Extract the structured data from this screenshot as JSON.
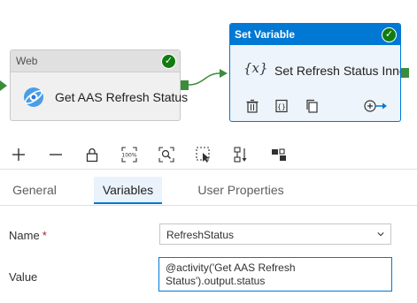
{
  "pipeline": {
    "web_activity": {
      "type_label": "Web",
      "name": "Get AAS Refresh Status",
      "status": "succeeded"
    },
    "set_variable_activity": {
      "type_label": "Set Variable",
      "name": "Set Refresh Status Inne",
      "status": "succeeded",
      "fx_symbol": "{x}"
    }
  },
  "toolbar": {
    "items": [
      "add-icon",
      "remove-icon",
      "lock-icon",
      "zoom-100-icon",
      "zoom-fit-icon",
      "select-icon",
      "auto-align-icon",
      "layout-icon"
    ],
    "zoom_100_label": "100%"
  },
  "tabs": [
    {
      "label": "General",
      "active": false
    },
    {
      "label": "Variables",
      "active": true
    },
    {
      "label": "User Properties",
      "active": false
    }
  ],
  "form": {
    "name_label": "Name",
    "required_marker": "*",
    "name_value": "RefreshStatus",
    "value_label": "Value",
    "value_text": "@activity('Get AAS Refresh Status').output.status"
  },
  "colors": {
    "accent": "#0078d4",
    "success": "#107c10",
    "connector": "#3c8c3c",
    "required": "#a4262c"
  }
}
